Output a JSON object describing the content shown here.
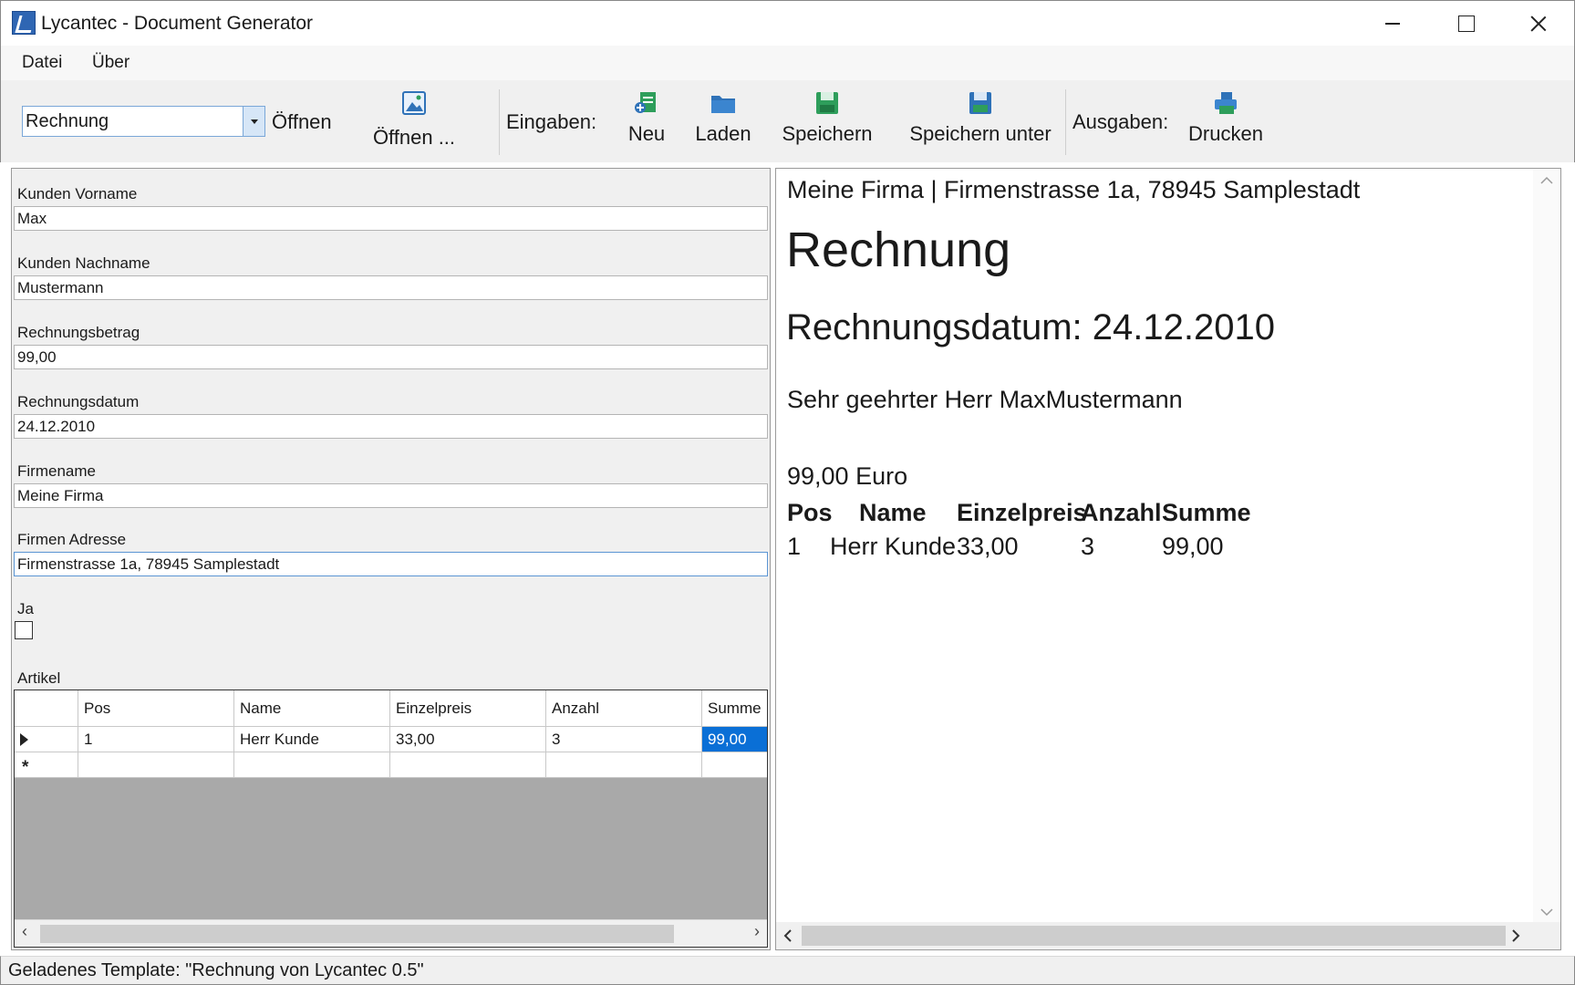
{
  "window": {
    "title": "Lycantec - Document Generator"
  },
  "menu": {
    "items": [
      "Datei",
      "Über"
    ]
  },
  "toolbar": {
    "template_combo_value": "Rechnung",
    "open_label": "Öffnen",
    "open_dialog_label": "Öffnen ...",
    "inputs_label": "Eingaben:",
    "new_label": "Neu",
    "load_label": "Laden",
    "save_label": "Speichern",
    "save_as_label": "Speichern unter",
    "outputs_label": "Ausgaben:",
    "print_label": "Drucken"
  },
  "form": {
    "fields": [
      {
        "label": "Kunden Vorname",
        "value": "Max"
      },
      {
        "label": "Kunden Nachname",
        "value": "Mustermann"
      },
      {
        "label": "Rechnungsbetrag",
        "value": "99,00"
      },
      {
        "label": "Rechnungsdatum",
        "value": "24.12.2010"
      },
      {
        "label": "Firmename",
        "value": "Meine Firma"
      },
      {
        "label": "Firmen Adresse",
        "value": "Firmenstrasse 1a, 78945 Samplestadt"
      }
    ],
    "checkbox_label": "Ja",
    "checkbox_checked": false,
    "grid_label": "Artikel",
    "grid": {
      "columns": [
        "Pos",
        "Name",
        "Einzelpreis",
        "Anzahl",
        "Summe"
      ],
      "rows": [
        [
          "1",
          "Herr Kunde",
          "33,00",
          "3",
          "99,00"
        ]
      ],
      "new_row_marker": "*"
    }
  },
  "preview": {
    "header": "Meine Firma | Firmenstrasse 1a, 78945 Samplestadt",
    "title": "Rechnung",
    "date_line": "Rechnungsdatum: 24.12.2010",
    "greeting": "Sehr geehrter Herr MaxMustermann",
    "amount": "99,00 Euro",
    "table": {
      "columns": [
        "Pos",
        "Name",
        "Einzelpreis",
        "Anzahl",
        "Summe"
      ],
      "rows": [
        [
          "1",
          "Herr Kunde",
          "33,00",
          "3",
          "99,00"
        ]
      ]
    }
  },
  "status": {
    "text": "Geladenes Template: \"Rechnung von  Lycantec 0.5\""
  },
  "colors": {
    "selection": "#0a6fd6",
    "icon_green": "#2e9e5b",
    "icon_blue": "#2f72b8"
  }
}
